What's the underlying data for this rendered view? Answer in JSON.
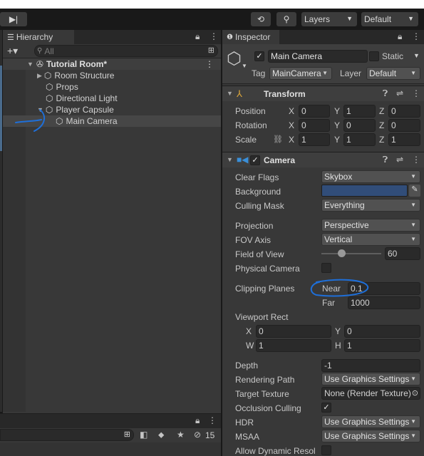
{
  "toolbar": {
    "play_glyph": "▶|",
    "history_glyph": "⟲",
    "search_glyph": "⚲",
    "layers": "Layers",
    "layout": "Default"
  },
  "hierarchy": {
    "tab_label": "Hierarchy",
    "add_glyph": "+▾",
    "search_placeholder": "All",
    "scene": "Tutorial Room*",
    "items": [
      "Room Structure",
      "Props",
      "Directional Light",
      "Player Capsule",
      "Main Camera"
    ]
  },
  "project": {
    "count_label": "15"
  },
  "inspector": {
    "tab_label": "Inspector",
    "object_name": "Main Camera",
    "static_label": "Static",
    "tag_label": "Tag",
    "tag_value": "MainCamera",
    "layer_label": "Layer",
    "layer_value": "Default",
    "transform": {
      "title": "Transform",
      "rows": [
        {
          "label": "Position",
          "x": "0",
          "y": "1",
          "z": "0"
        },
        {
          "label": "Rotation",
          "x": "0",
          "y": "0",
          "z": "0"
        },
        {
          "label": "Scale",
          "x": "1",
          "y": "1",
          "z": "1"
        }
      ],
      "x_label": "X",
      "y_label": "Y",
      "z_label": "Z"
    },
    "camera": {
      "title": "Camera",
      "clear_flags_label": "Clear Flags",
      "clear_flags_value": "Skybox",
      "background_label": "Background",
      "background_color": "#314d79",
      "culling_mask_label": "Culling Mask",
      "culling_mask_value": "Everything",
      "projection_label": "Projection",
      "projection_value": "Perspective",
      "fov_axis_label": "FOV Axis",
      "fov_axis_value": "Vertical",
      "fov_label": "Field of View",
      "fov_value": "60",
      "fov_slider_fraction": 0.33,
      "physical_label": "Physical Camera",
      "clipping_label": "Clipping Planes",
      "near_label": "Near",
      "near_value": "0.1",
      "far_label": "Far",
      "far_value": "1000",
      "viewport_label": "Viewport Rect",
      "vp_x_label": "X",
      "vp_x": "0",
      "vp_y_label": "Y",
      "vp_y": "0",
      "vp_w_label": "W",
      "vp_w": "1",
      "vp_h_label": "H",
      "vp_h": "1",
      "depth_label": "Depth",
      "depth_value": "-1",
      "rendering_path_label": "Rendering Path",
      "rendering_path_value": "Use Graphics Settings",
      "target_texture_label": "Target Texture",
      "target_texture_value": "None (Render Texture)",
      "occlusion_label": "Occlusion Culling",
      "hdr_label": "HDR",
      "hdr_value": "Use Graphics Settings",
      "msaa_label": "MSAA",
      "msaa_value": "Use Graphics Settings",
      "dynamic_label": "Allow Dynamic Resol"
    }
  },
  "colors": {
    "annotation": "#1e6fd9",
    "accent": "#3a79bb"
  }
}
